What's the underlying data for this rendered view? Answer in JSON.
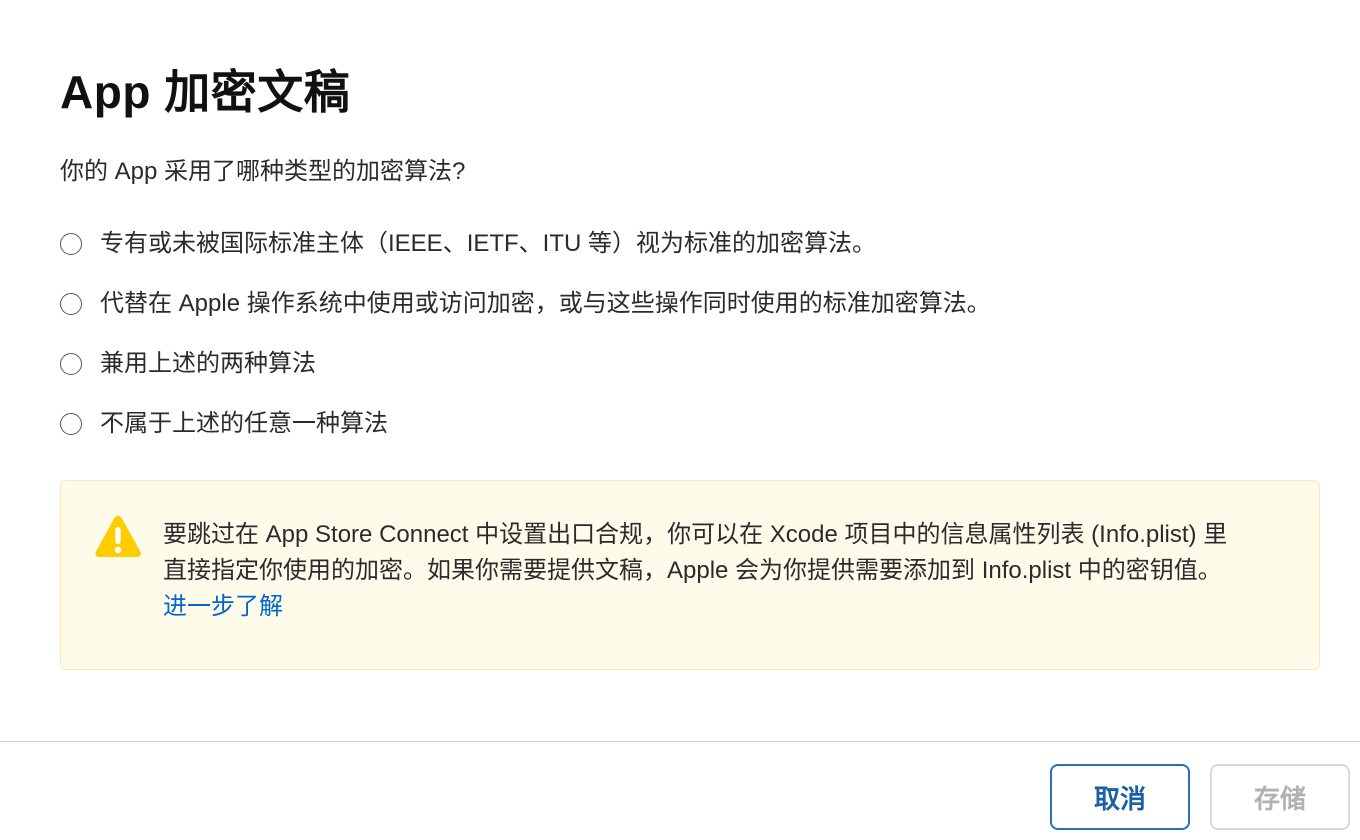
{
  "dialog": {
    "title": "App 加密文稿",
    "question": "你的 App 采用了哪种类型的加密算法?",
    "options": [
      {
        "label": "专有或未被国际标准主体（IEEE、IETF、ITU 等）视为标准的加密算法。",
        "selected": false
      },
      {
        "label": "代替在 Apple 操作系统中使用或访问加密，或与这些操作同时使用的标准加密算法。",
        "selected": false
      },
      {
        "label": "兼用上述的两种算法",
        "selected": false
      },
      {
        "label": "不属于上述的任意一种算法",
        "selected": false
      }
    ],
    "notice": {
      "icon": "warning-icon",
      "text": "要跳过在 App Store Connect 中设置出口合规，你可以在 Xcode 项目中的信息属性列表 (Info.plist) 里直接指定你使用的加密。如果你需要提供文稿，Apple 会为你提供需要添加到 Info.plist 中的密钥值。",
      "link_label": "进一步了解"
    }
  },
  "footer": {
    "cancel_label": "取消",
    "save_label": "存储"
  },
  "colors": {
    "accent": "#0066cc",
    "warning": "#ffcc00",
    "notice_background": "#fffbea"
  }
}
